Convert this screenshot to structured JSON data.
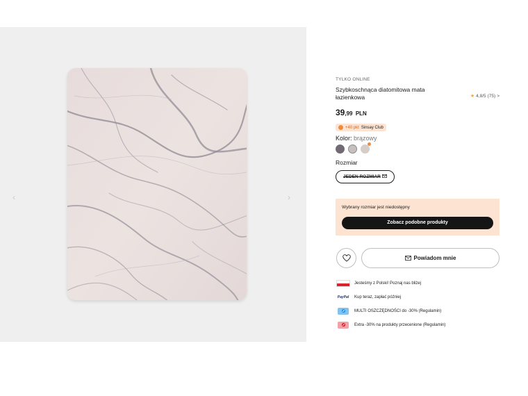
{
  "gallery": {
    "prev_arrow": "‹",
    "next_arrow": "›"
  },
  "product": {
    "online_label": "TYLKO ONLINE",
    "title": "Szybkoschnąca diatomitowa mata łazienkowa",
    "rating": "4,8/5",
    "rating_count": "(75)",
    "rating_chevron": ">",
    "price_main": "39",
    "price_cents": ",99",
    "currency": "PLN",
    "club_points": "+40 pkt",
    "club_name": "Sinsay Club",
    "color_label": "Kolor:",
    "color_value": "brązowy",
    "swatch_colors": [
      "#716a74",
      "#c7bebe",
      "#d6ccc8"
    ],
    "size_label": "Rozmiar",
    "size_option": "JEDEN ROZMIAR"
  },
  "availability": {
    "message": "Wybrany rozmiar jest niedostępny",
    "similar_button": "Zobacz podobne produkty"
  },
  "actions": {
    "notify_button": "Powiadom mnie"
  },
  "promos": [
    {
      "icon": "poland-flag-icon",
      "text": "Jesteśmy z Polski! Poznaj nas bliżej"
    },
    {
      "icon": "paypal-icon",
      "icon_text": "PayPal",
      "text": "Kup teraz, zapłać później"
    },
    {
      "icon": "discount-tag-icon",
      "text": "MULTI OSZCZĘDNOŚCI do -30% (Regulamin)"
    },
    {
      "icon": "sale-tag-icon",
      "text": "Extra -30% na produkty przecenione (Regulamin)"
    }
  ],
  "colors": {
    "accent_orange": "#f08a3c",
    "panel_peach": "#fde3d1",
    "button_dark": "#151515"
  }
}
